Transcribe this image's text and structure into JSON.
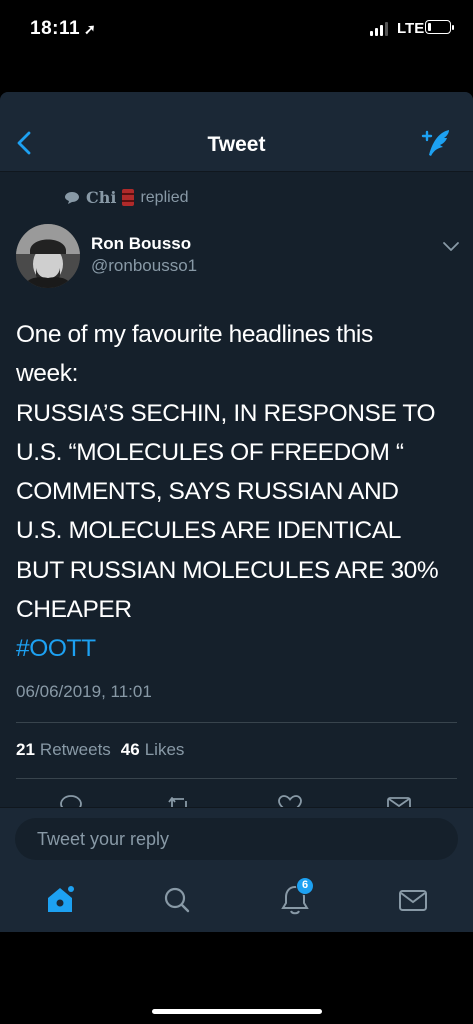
{
  "status_bar": {
    "time": "18:11",
    "network": "LTE",
    "battery_level": 0.1
  },
  "nav": {
    "title": "Tweet",
    "back_icon": "chevron-left-icon",
    "compose_icon": "compose-feather-icon"
  },
  "context": {
    "user": "Chi",
    "action": "replied",
    "icon": "speech-bubble-icon"
  },
  "tweet": {
    "author_name": "Ron Bousso",
    "author_handle": "@ronbousso1",
    "lines": [
      "One of my favourite headlines this",
      "week:",
      "RUSSIA’S SECHIN, IN RESPONSE TO",
      "U.S. “MOLECULES OF FREEDOM “",
      "COMMENTS, SAYS RUSSIAN AND",
      "U.S. MOLECULES ARE IDENTICAL",
      "BUT RUSSIAN MOLECULES ARE 30%",
      "CHEAPER"
    ],
    "hashtag": "#OOTT",
    "timestamp": "06/06/2019, 11:01",
    "retweet_count": "21",
    "retweet_label": "Retweets",
    "like_count": "46",
    "like_label": "Likes"
  },
  "reply": {
    "placeholder": "Tweet your reply"
  },
  "tabbar": {
    "notifications_badge": "6"
  },
  "colors": {
    "background": "#15202b",
    "bar": "#1b2836",
    "accent": "#1da1f2",
    "secondary_text": "#8899a6"
  }
}
